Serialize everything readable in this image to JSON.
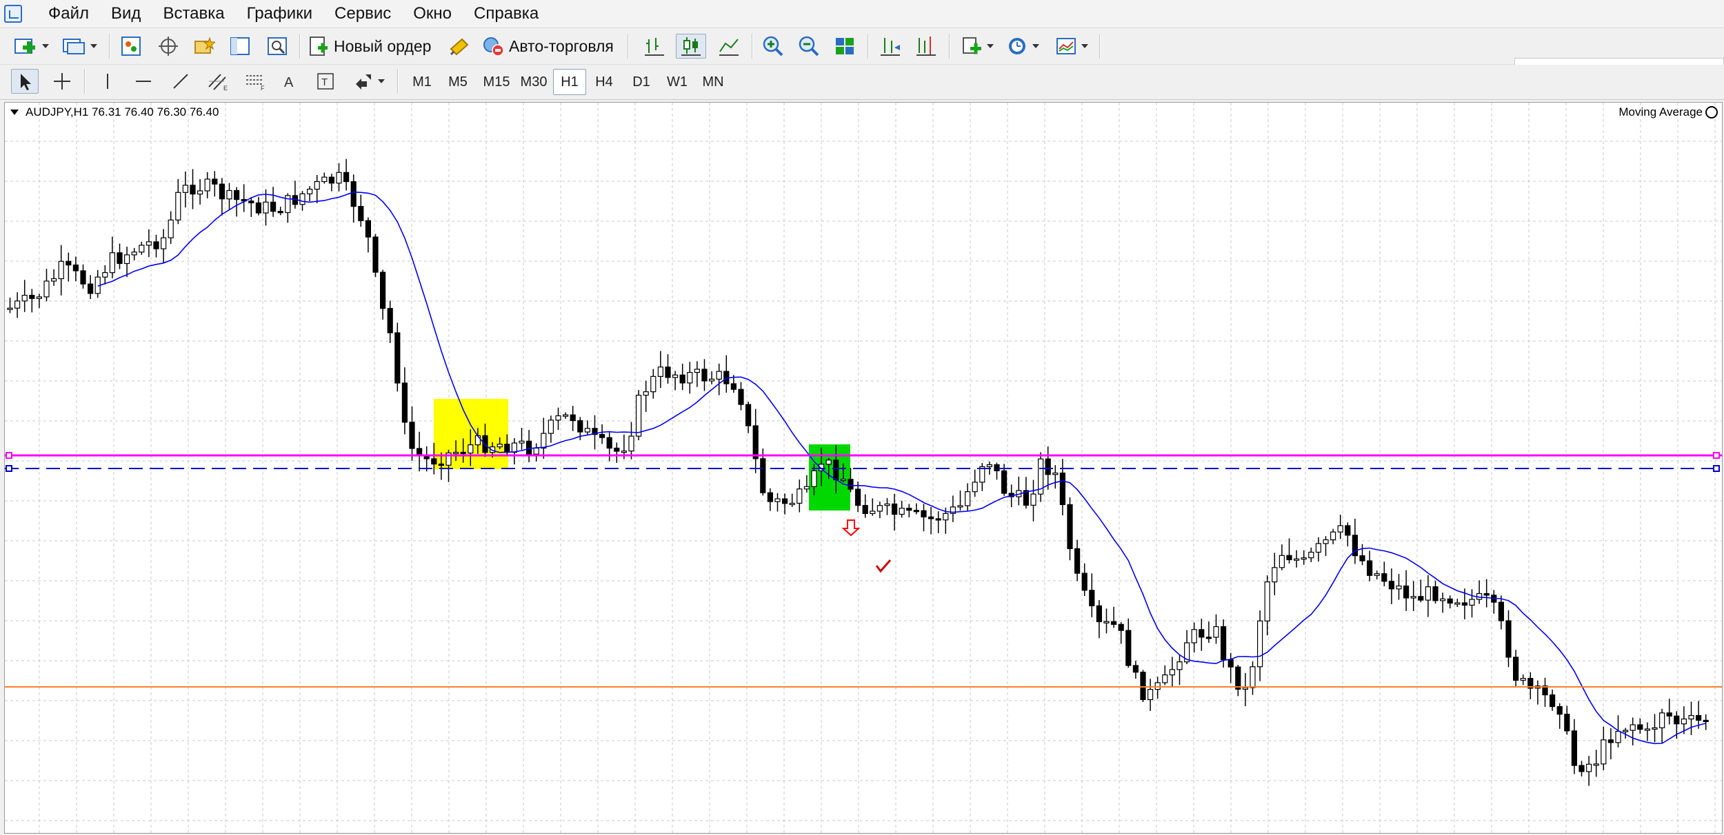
{
  "menu": {
    "items": [
      {
        "label": "Файл"
      },
      {
        "label": "Вид"
      },
      {
        "label": "Вставка"
      },
      {
        "label": "Графики"
      },
      {
        "label": "Сервис"
      },
      {
        "label": "Окно"
      },
      {
        "label": "Справка"
      }
    ]
  },
  "toolbar": {
    "new_order_label": "Новый ордер",
    "autotrading_label": "Авто-торговля",
    "active_chart_type": "candlesticks",
    "search_placeholder": ""
  },
  "timeframes": {
    "items": [
      "M1",
      "M5",
      "M15",
      "M30",
      "H1",
      "H4",
      "D1",
      "W1",
      "MN"
    ],
    "active": "H1"
  },
  "chart": {
    "info": "AUDJPY,H1  76.31 76.40 76.30 76.40",
    "indicator_label": "Moving Average",
    "colors": {
      "background": "#ffffff",
      "grid": "#c8c8c8",
      "candle": "#000000",
      "moving_average": "#0000ff",
      "hline_magenta": "#ff00ff",
      "hline_blue_dashed": "#0000c8",
      "hline_orange": "#ff7f27",
      "highlight_yellow": "#ffff00",
      "highlight_green": "#00d800",
      "sell_arrow": "#ff0000",
      "checkmark": "#cc0000"
    }
  },
  "chart_data": {
    "type": "candlestick",
    "symbol": "AUDJPY",
    "timeframe": "H1",
    "last_ohlc": {
      "open": 76.31,
      "high": 76.4,
      "low": 76.3,
      "close": 76.4
    },
    "indicator": "Moving Average",
    "grid": true,
    "horizontal_lines": [
      {
        "style": "solid",
        "color": "magenta"
      },
      {
        "style": "dashed",
        "color": "blue"
      },
      {
        "style": "solid",
        "color": "orange"
      }
    ],
    "highlight_boxes": [
      {
        "color": "yellow"
      },
      {
        "color": "green"
      }
    ],
    "markers": [
      "sell-arrow",
      "checkmark"
    ]
  }
}
